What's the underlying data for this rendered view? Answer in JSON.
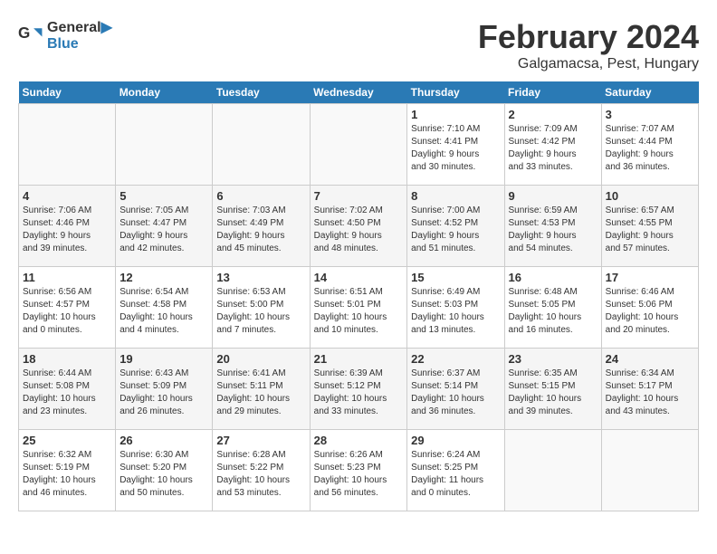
{
  "header": {
    "logo_line1": "General",
    "logo_line2": "Blue",
    "month": "February 2024",
    "location": "Galgamacsa, Pest, Hungary"
  },
  "days_of_week": [
    "Sunday",
    "Monday",
    "Tuesday",
    "Wednesday",
    "Thursday",
    "Friday",
    "Saturday"
  ],
  "weeks": [
    [
      {
        "day": "",
        "info": ""
      },
      {
        "day": "",
        "info": ""
      },
      {
        "day": "",
        "info": ""
      },
      {
        "day": "",
        "info": ""
      },
      {
        "day": "1",
        "info": "Sunrise: 7:10 AM\nSunset: 4:41 PM\nDaylight: 9 hours\nand 30 minutes."
      },
      {
        "day": "2",
        "info": "Sunrise: 7:09 AM\nSunset: 4:42 PM\nDaylight: 9 hours\nand 33 minutes."
      },
      {
        "day": "3",
        "info": "Sunrise: 7:07 AM\nSunset: 4:44 PM\nDaylight: 9 hours\nand 36 minutes."
      }
    ],
    [
      {
        "day": "4",
        "info": "Sunrise: 7:06 AM\nSunset: 4:46 PM\nDaylight: 9 hours\nand 39 minutes."
      },
      {
        "day": "5",
        "info": "Sunrise: 7:05 AM\nSunset: 4:47 PM\nDaylight: 9 hours\nand 42 minutes."
      },
      {
        "day": "6",
        "info": "Sunrise: 7:03 AM\nSunset: 4:49 PM\nDaylight: 9 hours\nand 45 minutes."
      },
      {
        "day": "7",
        "info": "Sunrise: 7:02 AM\nSunset: 4:50 PM\nDaylight: 9 hours\nand 48 minutes."
      },
      {
        "day": "8",
        "info": "Sunrise: 7:00 AM\nSunset: 4:52 PM\nDaylight: 9 hours\nand 51 minutes."
      },
      {
        "day": "9",
        "info": "Sunrise: 6:59 AM\nSunset: 4:53 PM\nDaylight: 9 hours\nand 54 minutes."
      },
      {
        "day": "10",
        "info": "Sunrise: 6:57 AM\nSunset: 4:55 PM\nDaylight: 9 hours\nand 57 minutes."
      }
    ],
    [
      {
        "day": "11",
        "info": "Sunrise: 6:56 AM\nSunset: 4:57 PM\nDaylight: 10 hours\nand 0 minutes."
      },
      {
        "day": "12",
        "info": "Sunrise: 6:54 AM\nSunset: 4:58 PM\nDaylight: 10 hours\nand 4 minutes."
      },
      {
        "day": "13",
        "info": "Sunrise: 6:53 AM\nSunset: 5:00 PM\nDaylight: 10 hours\nand 7 minutes."
      },
      {
        "day": "14",
        "info": "Sunrise: 6:51 AM\nSunset: 5:01 PM\nDaylight: 10 hours\nand 10 minutes."
      },
      {
        "day": "15",
        "info": "Sunrise: 6:49 AM\nSunset: 5:03 PM\nDaylight: 10 hours\nand 13 minutes."
      },
      {
        "day": "16",
        "info": "Sunrise: 6:48 AM\nSunset: 5:05 PM\nDaylight: 10 hours\nand 16 minutes."
      },
      {
        "day": "17",
        "info": "Sunrise: 6:46 AM\nSunset: 5:06 PM\nDaylight: 10 hours\nand 20 minutes."
      }
    ],
    [
      {
        "day": "18",
        "info": "Sunrise: 6:44 AM\nSunset: 5:08 PM\nDaylight: 10 hours\nand 23 minutes."
      },
      {
        "day": "19",
        "info": "Sunrise: 6:43 AM\nSunset: 5:09 PM\nDaylight: 10 hours\nand 26 minutes."
      },
      {
        "day": "20",
        "info": "Sunrise: 6:41 AM\nSunset: 5:11 PM\nDaylight: 10 hours\nand 29 minutes."
      },
      {
        "day": "21",
        "info": "Sunrise: 6:39 AM\nSunset: 5:12 PM\nDaylight: 10 hours\nand 33 minutes."
      },
      {
        "day": "22",
        "info": "Sunrise: 6:37 AM\nSunset: 5:14 PM\nDaylight: 10 hours\nand 36 minutes."
      },
      {
        "day": "23",
        "info": "Sunrise: 6:35 AM\nSunset: 5:15 PM\nDaylight: 10 hours\nand 39 minutes."
      },
      {
        "day": "24",
        "info": "Sunrise: 6:34 AM\nSunset: 5:17 PM\nDaylight: 10 hours\nand 43 minutes."
      }
    ],
    [
      {
        "day": "25",
        "info": "Sunrise: 6:32 AM\nSunset: 5:19 PM\nDaylight: 10 hours\nand 46 minutes."
      },
      {
        "day": "26",
        "info": "Sunrise: 6:30 AM\nSunset: 5:20 PM\nDaylight: 10 hours\nand 50 minutes."
      },
      {
        "day": "27",
        "info": "Sunrise: 6:28 AM\nSunset: 5:22 PM\nDaylight: 10 hours\nand 53 minutes."
      },
      {
        "day": "28",
        "info": "Sunrise: 6:26 AM\nSunset: 5:23 PM\nDaylight: 10 hours\nand 56 minutes."
      },
      {
        "day": "29",
        "info": "Sunrise: 6:24 AM\nSunset: 5:25 PM\nDaylight: 11 hours\nand 0 minutes."
      },
      {
        "day": "",
        "info": ""
      },
      {
        "day": "",
        "info": ""
      }
    ]
  ]
}
